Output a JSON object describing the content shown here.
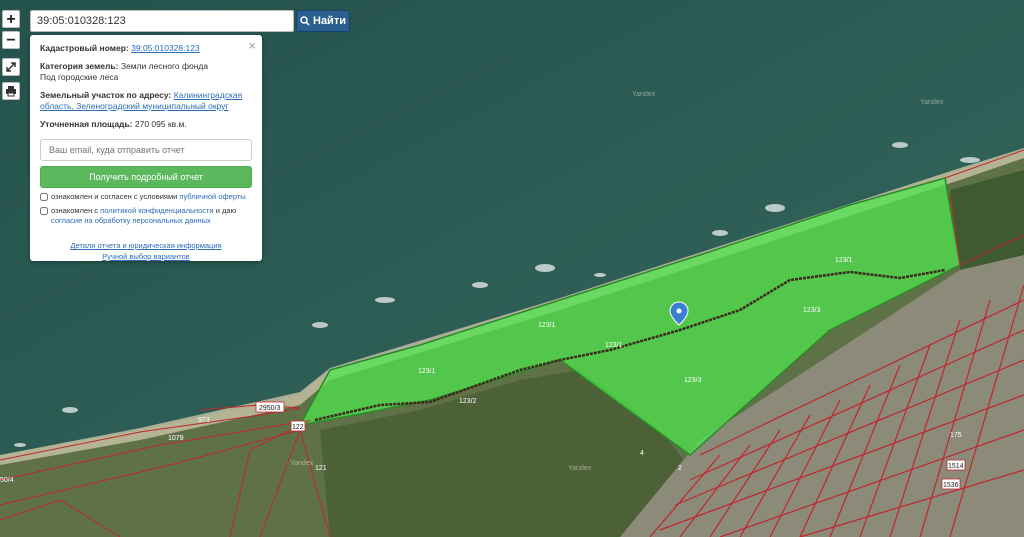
{
  "search": {
    "value": "39:05:010328:123",
    "button_label": "Найти",
    "button_icon": "search-icon"
  },
  "map_controls": {
    "zoom_in": "+",
    "zoom_out": "−",
    "fullscreen_icon": "expand-icon",
    "print_icon": "print-icon"
  },
  "info": {
    "cadastral_label": "Кадастровый номер:",
    "cadastral_value": "39:05:010328:123",
    "category_label": "Категория земель:",
    "category_value": "Земли лесного фонда",
    "usage": "Под городские леса",
    "address_label": "Земельный участок по адресу:",
    "address_line1": "Калининградская",
    "address_line2": "область, Зеленоградский муниципальный округ",
    "area_label": "Уточненная площадь:",
    "area_value": "270 095 кв.м.",
    "email_placeholder": "Ваш email, куда отправить отчет",
    "report_button": "Получить подробный отчет",
    "agree1_prefix": "ознакомлен и согласен с условиями",
    "agree1_link": "публичной оферты",
    "agree2_prefix": "ознакомлен с",
    "agree2_link1": "политикой конфиденциальности",
    "agree2_mid": "и даю",
    "agree2_link2": "согласие на обработку персональных данных",
    "link_details": "Детали отчета и юридическая информация",
    "link_manual": "Ручной выбор вариантов",
    "close": "×"
  },
  "map_labels": {
    "parcels": [
      "123/1",
      "123/1",
      "123/1",
      "123/1",
      "123/2",
      "123/3",
      "123/3",
      "2950/3",
      "121",
      "122",
      "121",
      "973",
      "1079",
      "2",
      "4",
      "1514",
      "1536",
      "175",
      "50/4"
    ],
    "watermarks": [
      "Yandex",
      "Yandex",
      "Yandex",
      "Yandex"
    ]
  },
  "colors": {
    "sea": "#2f5a52",
    "selected_parcel": "#4ee84e",
    "parcel_border": "#c0272d",
    "button_blue": "#2b5f8f",
    "button_green": "#5cb85c"
  }
}
